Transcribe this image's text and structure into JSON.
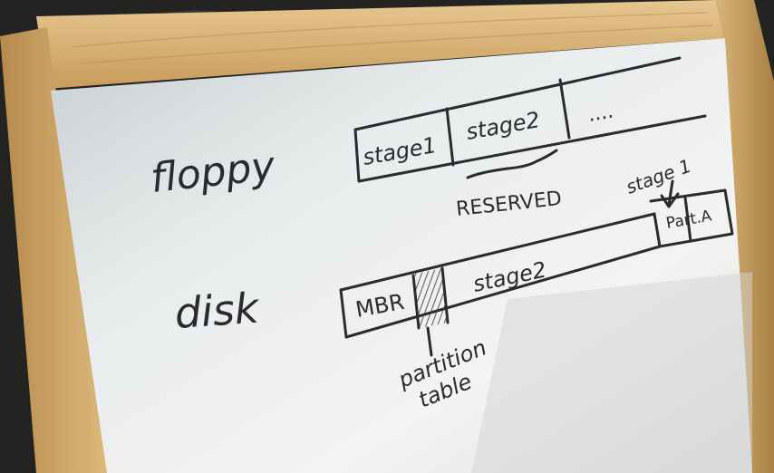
{
  "photo": {
    "subject": "whiteboard-sketch"
  },
  "rows": {
    "floppy": {
      "label": "floppy",
      "segments": {
        "stage1": "stage1",
        "stage2": "stage2",
        "more": "...."
      },
      "brace_label": "RESERVED"
    },
    "disk": {
      "label": "disk",
      "segments": {
        "mbr": "MBR",
        "stage2": "stage2",
        "part": "Part.A"
      },
      "stage1_note": "stage 1",
      "partition_label_line1": "partition",
      "partition_label_line2": "table"
    }
  },
  "colors": {
    "frame": "#d9b57a",
    "frame_shadow": "#8a6a3a",
    "board": "#e9ecec",
    "marker": "#2a2a30"
  }
}
